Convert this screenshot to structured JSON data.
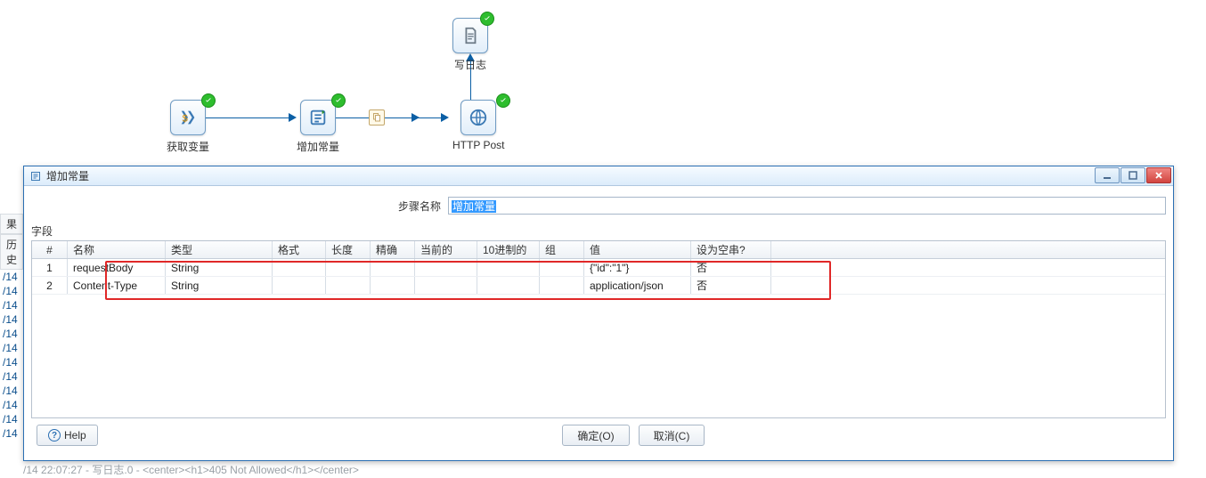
{
  "canvas": {
    "nodes": {
      "get_var": "获取变量",
      "add_const": "增加常量",
      "http_post": "HTTP Post",
      "write_log": "写日志"
    }
  },
  "gutter": {
    "head_top": "果",
    "head_sub": "历史",
    "items": [
      "/14",
      "/14",
      "/14",
      "/14",
      "/14",
      "/14",
      "/14",
      "/14",
      "/14",
      "/14",
      "/14",
      "/14"
    ]
  },
  "dialog": {
    "title": "增加常量",
    "step_label": "步骤名称",
    "step_value": "增加常量",
    "section_fields": "字段",
    "columns": {
      "hash": "#",
      "name": "名称",
      "type": "类型",
      "fmt": "格式",
      "len": "长度",
      "prec": "精确",
      "cur": "当前的",
      "dec": "10进制的",
      "grp": "组",
      "val": "值",
      "empty": "设为空串?"
    },
    "rows": [
      {
        "idx": "1",
        "name": "requestBody",
        "type": "String",
        "val": "{\"id\":\"1\"}",
        "empty": "否"
      },
      {
        "idx": "2",
        "name": "Content-Type",
        "type": "String",
        "val": "application/json",
        "empty": "否"
      }
    ],
    "buttons": {
      "help": "Help",
      "ok": "确定(O)",
      "cancel": "取消(C)"
    }
  },
  "bottom_line": "/14 22:07:27 - 写日志.0 - <center><h1>405 Not Allowed</h1></center>"
}
